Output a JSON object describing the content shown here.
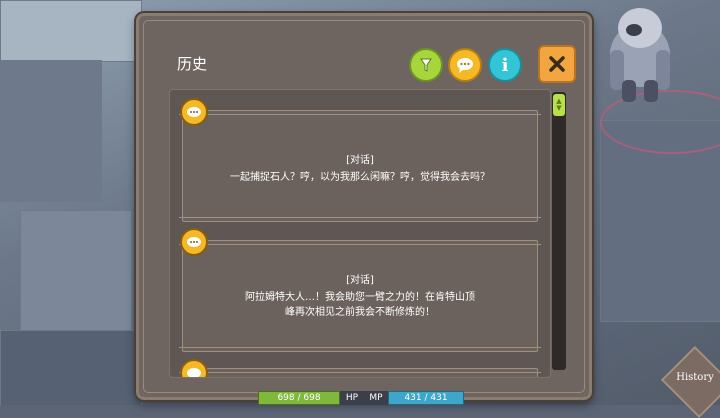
{
  "window": {
    "title": "历史"
  },
  "header_buttons": {
    "filter_icon": "filter-icon",
    "talk_icon": "speech-bubble-icon",
    "info_icon": "info-icon",
    "info_label": "i",
    "close_icon": "close-icon"
  },
  "entries": [
    {
      "tag": "[对话]",
      "text": "一起捕捉石人？哼，以为我那么闲嘛？哼，觉得我会去吗？"
    },
    {
      "tag": "[对话]",
      "text": "阿拉姆特大人…！我会助您一臂之力的！在肯特山顶峰再次相见之前我会不断修炼的！"
    },
    {
      "tag": "",
      "text": ""
    }
  ],
  "hud": {
    "hp_value": "698 / 698",
    "hp_label": "HP",
    "mp_label": "MP",
    "mp_value": "431 / 431"
  },
  "history_button": {
    "label": "History"
  },
  "colors": {
    "accent_green": "#a6d63c",
    "accent_orange": "#f5b827",
    "accent_cyan": "#33c4d6",
    "panel_bg": "#6f6560"
  }
}
